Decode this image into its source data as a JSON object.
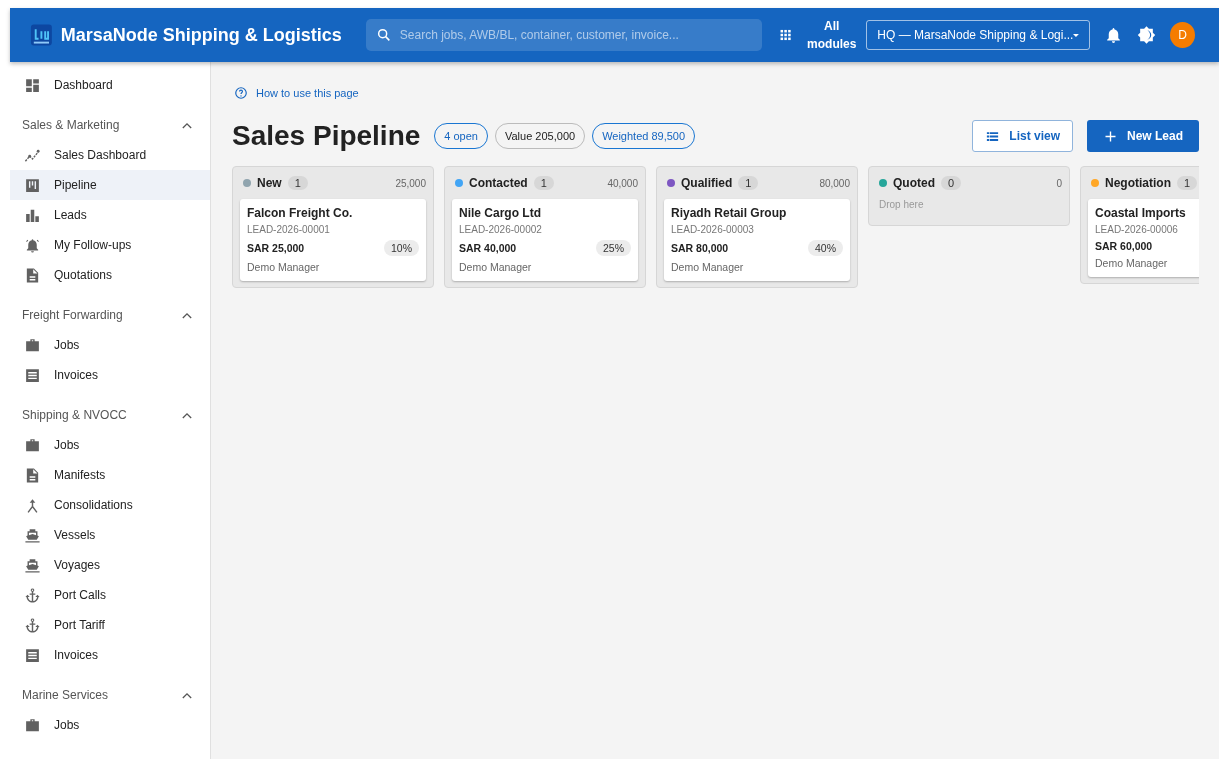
{
  "header": {
    "app_name": "MarsaNode Shipping & Logistics",
    "search": {
      "placeholder": "Search jobs, AWB/BL, container, customer, invoice..."
    },
    "modules_label": "All modules",
    "branch": "HQ — MarsaNode Shipping & Logi...",
    "avatar": "D"
  },
  "sidebar": {
    "top": [
      {
        "label": "Dashboard",
        "kind": "dashboard",
        "selected": false
      }
    ],
    "sections": [
      {
        "title": "Sales & Marketing",
        "expanded": true,
        "items": [
          {
            "label": "Sales Dashboard",
            "kind": "trend",
            "selected": false
          },
          {
            "label": "Pipeline",
            "kind": "pipeline",
            "selected": true
          },
          {
            "label": "Leads",
            "kind": "bars",
            "selected": false
          },
          {
            "label": "My Follow-ups",
            "kind": "bell",
            "selected": false
          },
          {
            "label": "Quotations",
            "kind": "doc",
            "selected": false
          }
        ]
      },
      {
        "title": "Freight Forwarding",
        "expanded": true,
        "items": [
          {
            "label": "Jobs",
            "kind": "case",
            "selected": false
          },
          {
            "label": "Invoices",
            "kind": "receipt",
            "selected": false
          }
        ]
      },
      {
        "title": "Shipping & NVOCC",
        "expanded": true,
        "items": [
          {
            "label": "Jobs",
            "kind": "case",
            "selected": false
          },
          {
            "label": "Manifests",
            "kind": "doc",
            "selected": false
          },
          {
            "label": "Consolidations",
            "kind": "merge",
            "selected": false
          },
          {
            "label": "Vessels",
            "kind": "ship",
            "selected": false
          },
          {
            "label": "Voyages",
            "kind": "ship",
            "selected": false
          },
          {
            "label": "Port Calls",
            "kind": "anchor",
            "selected": false
          },
          {
            "label": "Port Tariff",
            "kind": "anchor",
            "selected": false
          },
          {
            "label": "Invoices",
            "kind": "receipt",
            "selected": false
          }
        ]
      },
      {
        "title": "Marine Services",
        "expanded": true,
        "items": [
          {
            "label": "Jobs",
            "kind": "case",
            "selected": false
          }
        ]
      }
    ]
  },
  "help_link": "How to use this page",
  "page_title": "Sales Pipeline",
  "chips": [
    {
      "text": "4 open",
      "kind": "accent"
    },
    {
      "text": "Value 205,000",
      "kind": "neutral"
    },
    {
      "text": "Weighted 89,500",
      "kind": "accent"
    }
  ],
  "actions": [
    {
      "label": "List view",
      "kind": "outline"
    },
    {
      "label": "New Lead",
      "kind": "primary"
    }
  ],
  "columns": [
    {
      "name": "New",
      "color": "#90a4ae",
      "count": "1",
      "total": "25,000",
      "cards": [
        {
          "company": "Falcon Freight Co.",
          "ref": "LEAD-2026-00001",
          "amount": "SAR 25,000",
          "probability": "10%",
          "owner": "Demo Manager"
        }
      ]
    },
    {
      "name": "Contacted",
      "color": "#42a5f5",
      "count": "1",
      "total": "40,000",
      "cards": [
        {
          "company": "Nile Cargo Ltd",
          "ref": "LEAD-2026-00002",
          "amount": "SAR 40,000",
          "probability": "25%",
          "owner": "Demo Manager"
        }
      ]
    },
    {
      "name": "Qualified",
      "color": "#7e57c2",
      "count": "1",
      "total": "80,000",
      "cards": [
        {
          "company": "Riyadh Retail Group",
          "ref": "LEAD-2026-00003",
          "amount": "SAR 80,000",
          "probability": "40%",
          "owner": "Demo Manager"
        }
      ]
    },
    {
      "name": "Quoted",
      "color": "#26a69a",
      "count": "0",
      "total": "0",
      "empty_hint": "Drop here"
    },
    {
      "name": "Negotiation",
      "color": "#ffa726",
      "count": "1",
      "cards": [
        {
          "company": "Coastal Imports",
          "ref": "LEAD-2026-00006",
          "amount": "SAR 60,000",
          "owner": "Demo Manager"
        }
      ]
    }
  ]
}
